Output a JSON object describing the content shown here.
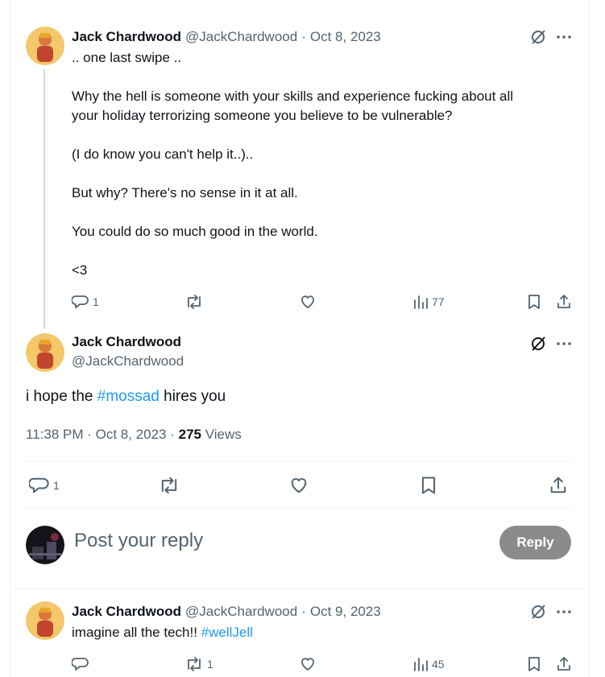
{
  "tweet1": {
    "name": "Jack Chardwood",
    "handle": "@JackChardwood",
    "dot": "·",
    "date": "Oct 8, 2023",
    "lines": [
      ".. one last swipe ..",
      "Why the hell is someone with your skills and experience fucking about all",
      "your holiday terrorizing someone you believe to be vulnerable?",
      "(I do know you can't help it..)..",
      "But why? There's no sense in it at all.",
      "You could do so much good in the world.",
      "<3"
    ],
    "reply_count": "1",
    "views": "77"
  },
  "main": {
    "name": "Jack Chardwood",
    "handle": "@JackChardwood",
    "text_before": "i hope the ",
    "hashtag": "#mossad",
    "text_after": " hires you",
    "time": "11:38 PM · Oct 8, 2023 · ",
    "views_count": "275",
    "views_label": " Views",
    "reply_count": "1"
  },
  "composer": {
    "placeholder": "Post your reply",
    "button": "Reply"
  },
  "tweet3": {
    "name": "Jack Chardwood",
    "handle": "@JackChardwood",
    "dot": "·",
    "date": "Oct 9, 2023",
    "text_before": "imagine all the tech!! ",
    "hashtag": "#wellJell",
    "repost_count": "1",
    "views": "45"
  },
  "icons": [
    "grok-icon",
    "more-icon",
    "reply-icon",
    "repost-icon",
    "like-icon",
    "views-icon",
    "bookmark-icon",
    "share-icon"
  ],
  "colors": {
    "accent": "#1d9bf0",
    "muted": "#536471",
    "reply_button": "#8b8b8b"
  }
}
